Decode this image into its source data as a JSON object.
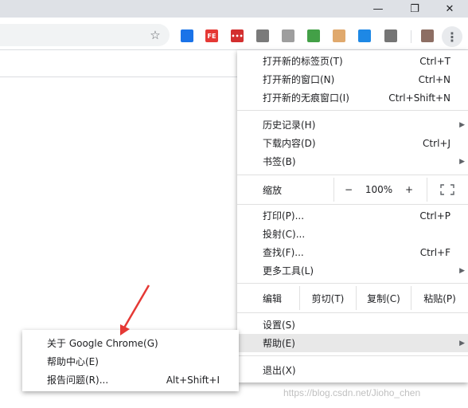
{
  "window": {
    "minimize_icon": "minimize-icon",
    "restore_icon": "restore-icon",
    "close_icon": "close-icon"
  },
  "toolbar": {
    "extensions": [
      {
        "name": "translate-ext-icon",
        "label": "",
        "color": "#1a73e8"
      },
      {
        "name": "fe-ext-icon",
        "label": "FE",
        "color": "#e53935"
      },
      {
        "name": "dots-ext-icon",
        "label": "•••",
        "color": "#d32f2f"
      },
      {
        "name": "vue-ext-icon",
        "label": "",
        "color": "#7a7a7a"
      },
      {
        "name": "puzzle-ext-icon",
        "label": "",
        "color": "#9e9e9e"
      },
      {
        "name": "shield-ext-icon",
        "label": "",
        "color": "#43a047"
      },
      {
        "name": "robot-ext-icon",
        "label": "",
        "color": "#e0a96d"
      },
      {
        "name": "pocket-ext-icon",
        "label": "",
        "color": "#1e88e5"
      },
      {
        "name": "circle-ext-icon",
        "label": "",
        "color": "#757575"
      },
      {
        "name": "wrench-ext-icon",
        "label": "",
        "color": "#8d6e63"
      }
    ]
  },
  "menu": {
    "new_tab": {
      "label": "打开新的标签页(T)",
      "shortcut": "Ctrl+T"
    },
    "new_window": {
      "label": "打开新的窗口(N)",
      "shortcut": "Ctrl+N"
    },
    "incognito": {
      "label": "打开新的无痕窗口(I)",
      "shortcut": "Ctrl+Shift+N"
    },
    "history": {
      "label": "历史记录(H)"
    },
    "downloads": {
      "label": "下载内容(D)",
      "shortcut": "Ctrl+J"
    },
    "bookmarks": {
      "label": "书签(B)"
    },
    "zoom": {
      "label": "缩放",
      "minus": "−",
      "value": "100%",
      "plus": "+"
    },
    "print": {
      "label": "打印(P)...",
      "shortcut": "Ctrl+P"
    },
    "cast": {
      "label": "投射(C)..."
    },
    "find": {
      "label": "查找(F)...",
      "shortcut": "Ctrl+F"
    },
    "more_tools": {
      "label": "更多工具(L)"
    },
    "edit": {
      "label": "编辑",
      "cut": "剪切(T)",
      "copy": "复制(C)",
      "paste": "粘贴(P)"
    },
    "settings": {
      "label": "设置(S)"
    },
    "help": {
      "label": "帮助(E)"
    },
    "exit": {
      "label": "退出(X)"
    }
  },
  "submenu": {
    "about": {
      "label": "关于 Google Chrome(G)"
    },
    "help_center": {
      "label": "帮助中心(E)"
    },
    "report": {
      "label": "报告问题(R)...",
      "shortcut": "Alt+Shift+I"
    }
  },
  "watermark": "https://blog.csdn.net/Jioho_chen"
}
